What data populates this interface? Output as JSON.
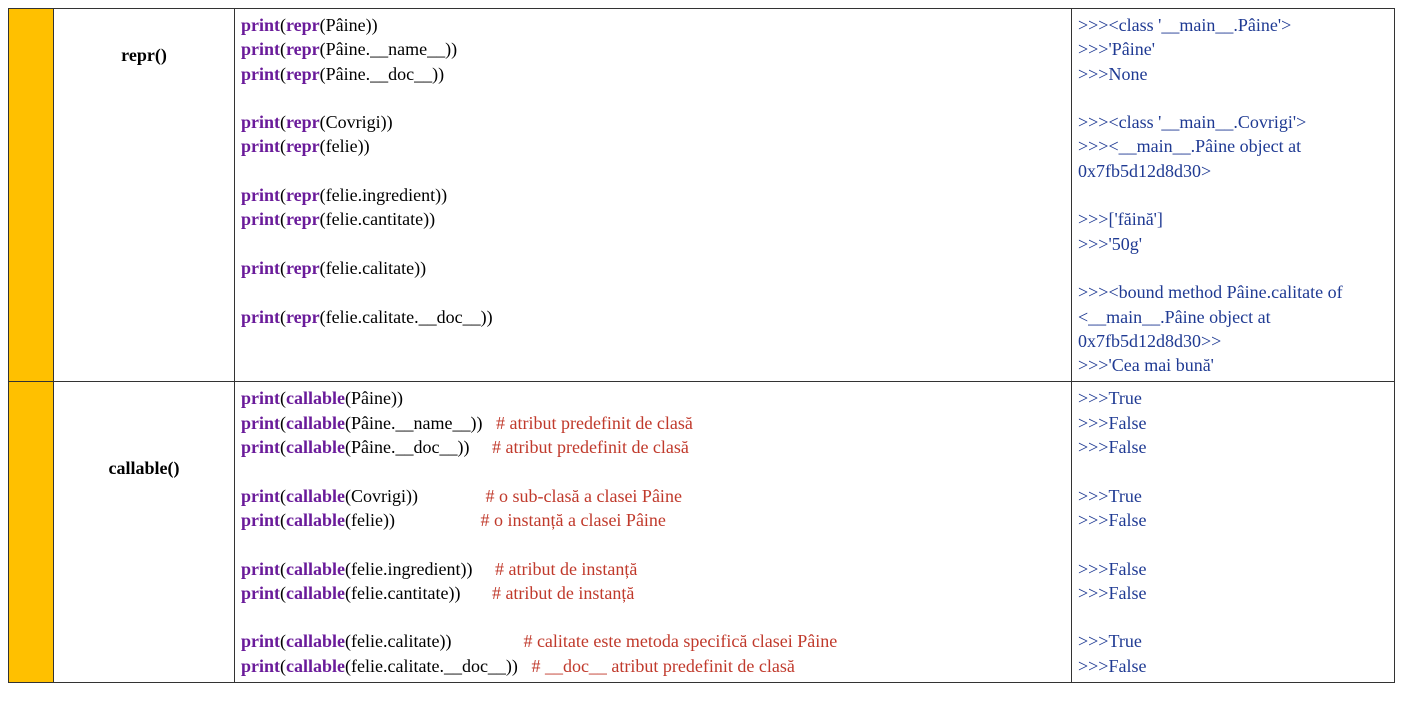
{
  "row1": {
    "label": "repr()",
    "code_lines": [
      [
        {
          "t": "print",
          "c": "kw"
        },
        {
          "t": "("
        },
        {
          "t": "repr",
          "c": "kw"
        },
        {
          "t": "(Pâine))"
        }
      ],
      [
        {
          "t": "print",
          "c": "kw"
        },
        {
          "t": "("
        },
        {
          "t": "repr",
          "c": "kw"
        },
        {
          "t": "(Pâine.__name__))"
        }
      ],
      [
        {
          "t": "print",
          "c": "kw"
        },
        {
          "t": "("
        },
        {
          "t": "repr",
          "c": "kw"
        },
        {
          "t": "(Pâine.__doc__))"
        }
      ],
      [],
      [
        {
          "t": "print",
          "c": "kw"
        },
        {
          "t": "("
        },
        {
          "t": "repr",
          "c": "kw"
        },
        {
          "t": "(Covrigi))"
        }
      ],
      [
        {
          "t": "print",
          "c": "kw"
        },
        {
          "t": "("
        },
        {
          "t": "repr",
          "c": "kw"
        },
        {
          "t": "(felie))"
        }
      ],
      [],
      [
        {
          "t": "print",
          "c": "kw"
        },
        {
          "t": "("
        },
        {
          "t": "repr",
          "c": "kw"
        },
        {
          "t": "(felie.ingredient))"
        }
      ],
      [
        {
          "t": "print",
          "c": "kw"
        },
        {
          "t": "("
        },
        {
          "t": "repr",
          "c": "kw"
        },
        {
          "t": "(felie.cantitate))"
        }
      ],
      [],
      [
        {
          "t": "print",
          "c": "kw"
        },
        {
          "t": "("
        },
        {
          "t": "repr",
          "c": "kw"
        },
        {
          "t": "(felie.calitate))"
        }
      ],
      [],
      [
        {
          "t": "print",
          "c": "kw"
        },
        {
          "t": "("
        },
        {
          "t": "repr",
          "c": "kw"
        },
        {
          "t": "(felie.calitate.__doc__))"
        }
      ]
    ],
    "out_lines": [
      [
        {
          "t": ">>>",
          "c": "out"
        },
        {
          "t": "<class '__main__.Pâine'>",
          "c": "out"
        }
      ],
      [
        {
          "t": ">>>",
          "c": "out"
        },
        {
          "t": "'Pâine'",
          "c": "out"
        }
      ],
      [
        {
          "t": ">>>",
          "c": "out"
        },
        {
          "t": "None",
          "c": "out"
        }
      ],
      [],
      [
        {
          "t": ">>>",
          "c": "out"
        },
        {
          "t": "<class '__main__.Covrigi'>",
          "c": "out"
        }
      ],
      [
        {
          "t": ">>>",
          "c": "out"
        },
        {
          "t": "<__main__.Pâine object at 0x7fb5d12d8d30>",
          "c": "out"
        }
      ],
      [],
      [
        {
          "t": ">>>",
          "c": "out"
        },
        {
          "t": "['făină']",
          "c": "out"
        }
      ],
      [
        {
          "t": ">>>",
          "c": "out"
        },
        {
          "t": "'50g'",
          "c": "out"
        }
      ],
      [],
      [
        {
          "t": ">>>",
          "c": "out"
        },
        {
          "t": "<bound method Pâine.calitate of <__main__.Pâine object at 0x7fb5d12d8d30>>",
          "c": "out"
        }
      ],
      [
        {
          "t": ">>>",
          "c": "out"
        },
        {
          "t": "'Cea mai bună'",
          "c": "out"
        }
      ]
    ]
  },
  "row2": {
    "label": "callable()",
    "code_lines": [
      [
        {
          "t": "print",
          "c": "kw"
        },
        {
          "t": "("
        },
        {
          "t": "callable",
          "c": "kw"
        },
        {
          "t": "(Pâine))"
        }
      ],
      [
        {
          "t": "print",
          "c": "kw"
        },
        {
          "t": "("
        },
        {
          "t": "callable",
          "c": "kw"
        },
        {
          "t": "(Pâine.__name__))   "
        },
        {
          "t": "# atribut predefinit de clasă",
          "c": "cmt"
        }
      ],
      [
        {
          "t": "print",
          "c": "kw"
        },
        {
          "t": "("
        },
        {
          "t": "callable",
          "c": "kw"
        },
        {
          "t": "(Pâine.__doc__))     "
        },
        {
          "t": "# atribut predefinit de clasă",
          "c": "cmt"
        }
      ],
      [],
      [
        {
          "t": "print",
          "c": "kw"
        },
        {
          "t": "("
        },
        {
          "t": "callable",
          "c": "kw"
        },
        {
          "t": "(Covrigi))               "
        },
        {
          "t": "# o sub-clasă a clasei Pâine",
          "c": "cmt"
        }
      ],
      [
        {
          "t": "print",
          "c": "kw"
        },
        {
          "t": "("
        },
        {
          "t": "callable",
          "c": "kw"
        },
        {
          "t": "(felie))                   "
        },
        {
          "t": "# o instanță a clasei Pâine",
          "c": "cmt"
        }
      ],
      [],
      [
        {
          "t": "print",
          "c": "kw"
        },
        {
          "t": "("
        },
        {
          "t": "callable",
          "c": "kw"
        },
        {
          "t": "(felie.ingredient))     "
        },
        {
          "t": "# atribut de instanță",
          "c": "cmt"
        }
      ],
      [
        {
          "t": "print",
          "c": "kw"
        },
        {
          "t": "("
        },
        {
          "t": "callable",
          "c": "kw"
        },
        {
          "t": "(felie.cantitate))       "
        },
        {
          "t": "# atribut de instanță",
          "c": "cmt"
        }
      ],
      [],
      [
        {
          "t": "print",
          "c": "kw"
        },
        {
          "t": "("
        },
        {
          "t": "callable",
          "c": "kw"
        },
        {
          "t": "(felie.calitate))                "
        },
        {
          "t": "# calitate este metoda specifică clasei Pâine",
          "c": "cmt"
        }
      ],
      [
        {
          "t": "print",
          "c": "kw"
        },
        {
          "t": "("
        },
        {
          "t": "callable",
          "c": "kw"
        },
        {
          "t": "(felie.calitate.__doc__))   "
        },
        {
          "t": "# __doc__ atribut predefinit de clasă",
          "c": "cmt"
        }
      ]
    ],
    "out_lines": [
      [
        {
          "t": ">>>",
          "c": "out"
        },
        {
          "t": "True",
          "c": "out"
        }
      ],
      [
        {
          "t": ">>>",
          "c": "out"
        },
        {
          "t": "False",
          "c": "out"
        }
      ],
      [
        {
          "t": ">>>",
          "c": "out"
        },
        {
          "t": "False",
          "c": "out"
        }
      ],
      [],
      [
        {
          "t": ">>>",
          "c": "out"
        },
        {
          "t": "True",
          "c": "out"
        }
      ],
      [
        {
          "t": ">>>",
          "c": "out"
        },
        {
          "t": "False",
          "c": "out"
        }
      ],
      [],
      [
        {
          "t": ">>>",
          "c": "out"
        },
        {
          "t": "False",
          "c": "out"
        }
      ],
      [
        {
          "t": ">>>",
          "c": "out"
        },
        {
          "t": "False",
          "c": "out"
        }
      ],
      [],
      [
        {
          "t": ">>>",
          "c": "out"
        },
        {
          "t": "True",
          "c": "out"
        }
      ],
      [
        {
          "t": ">>>",
          "c": "out"
        },
        {
          "t": "False",
          "c": "out"
        }
      ]
    ]
  }
}
